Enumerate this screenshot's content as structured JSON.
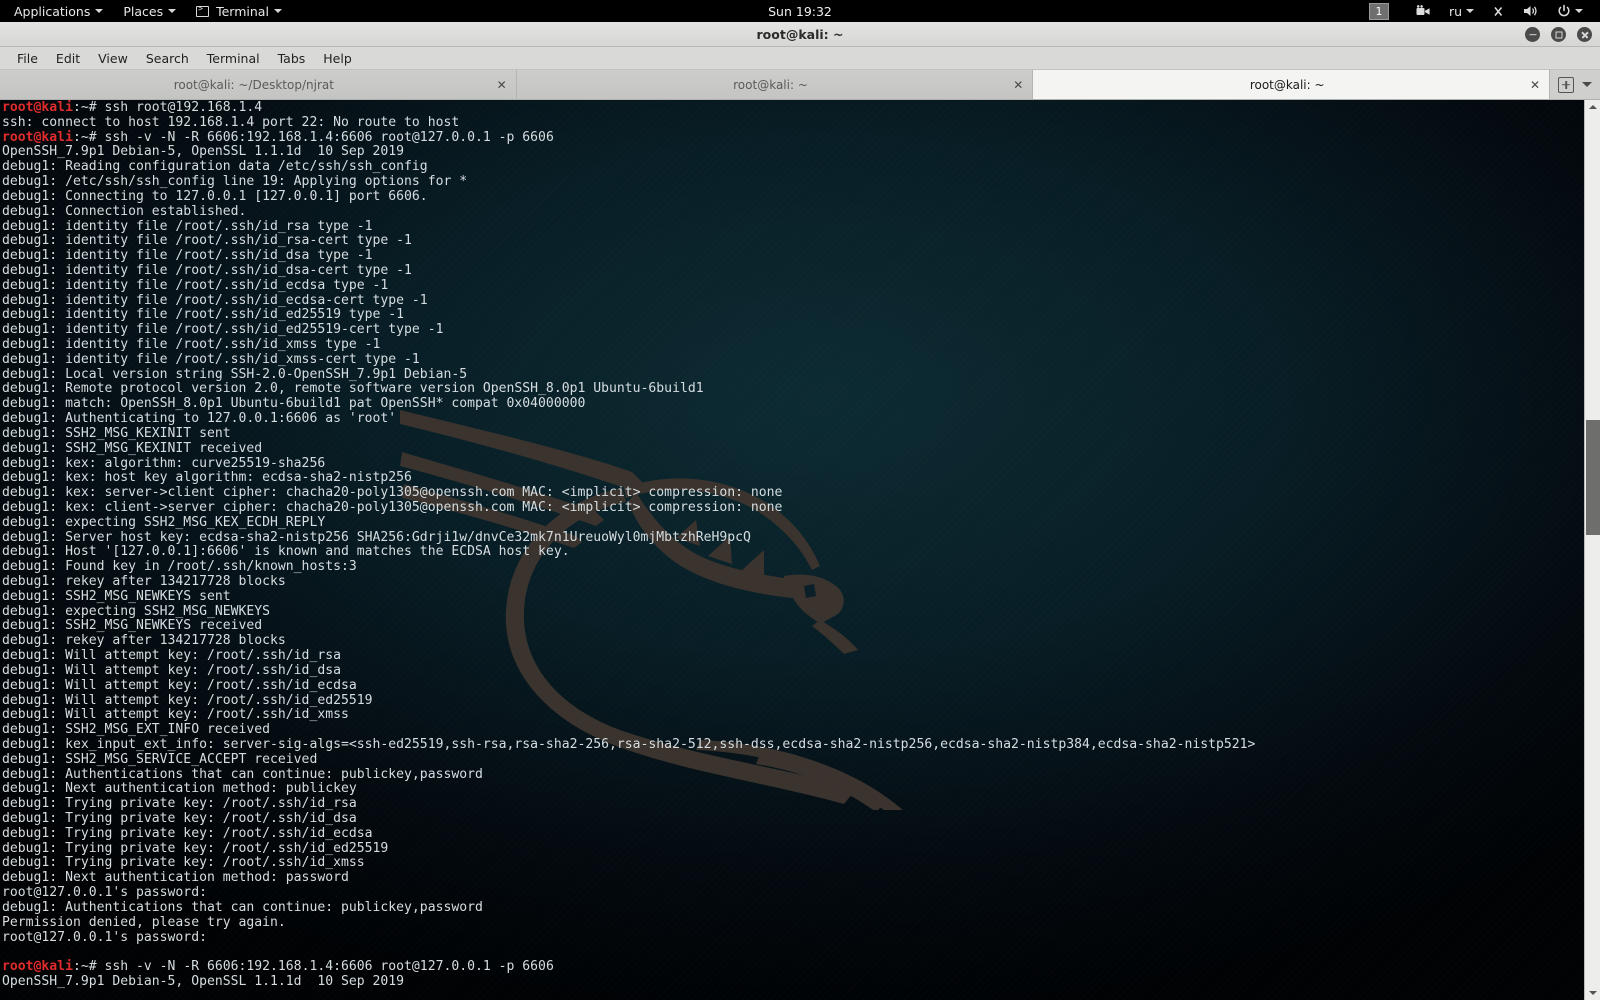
{
  "panel": {
    "applications": "Applications",
    "places": "Places",
    "terminal": "Terminal",
    "clock": "Sun 19:32",
    "workspace": "1",
    "keyboard_layout": "ru"
  },
  "window": {
    "title": "root@kali: ~"
  },
  "menubar": [
    "File",
    "Edit",
    "View",
    "Search",
    "Terminal",
    "Tabs",
    "Help"
  ],
  "tabs": [
    {
      "label": "root@kali: ~/Desktop/njrat",
      "close": "✕",
      "active": false
    },
    {
      "label": "root@kali: ~",
      "close": "✕",
      "active": false
    },
    {
      "label": "root@kali: ~",
      "close": "✕",
      "active": true
    }
  ],
  "colors": {
    "prompt_red": "#e02c2c",
    "terminal_fg": "#d6dde0",
    "terminal_bg": "#04151c",
    "dragon": "#3a332e"
  },
  "terminal": {
    "prompt_user": "root@kali",
    "prompt_tail": ":~# ",
    "lines": [
      {
        "prompt": true,
        "text": "ssh root@192.168.1.4"
      },
      {
        "prompt": false,
        "text": "ssh: connect to host 192.168.1.4 port 22: No route to host"
      },
      {
        "prompt": true,
        "text": "ssh -v -N -R 6606:192.168.1.4:6606 root@127.0.0.1 -p 6606"
      },
      {
        "prompt": false,
        "text": "OpenSSH_7.9p1 Debian-5, OpenSSL 1.1.1d  10 Sep 2019"
      },
      {
        "prompt": false,
        "text": "debug1: Reading configuration data /etc/ssh/ssh_config"
      },
      {
        "prompt": false,
        "text": "debug1: /etc/ssh/ssh_config line 19: Applying options for *"
      },
      {
        "prompt": false,
        "text": "debug1: Connecting to 127.0.0.1 [127.0.0.1] port 6606."
      },
      {
        "prompt": false,
        "text": "debug1: Connection established."
      },
      {
        "prompt": false,
        "text": "debug1: identity file /root/.ssh/id_rsa type -1"
      },
      {
        "prompt": false,
        "text": "debug1: identity file /root/.ssh/id_rsa-cert type -1"
      },
      {
        "prompt": false,
        "text": "debug1: identity file /root/.ssh/id_dsa type -1"
      },
      {
        "prompt": false,
        "text": "debug1: identity file /root/.ssh/id_dsa-cert type -1"
      },
      {
        "prompt": false,
        "text": "debug1: identity file /root/.ssh/id_ecdsa type -1"
      },
      {
        "prompt": false,
        "text": "debug1: identity file /root/.ssh/id_ecdsa-cert type -1"
      },
      {
        "prompt": false,
        "text": "debug1: identity file /root/.ssh/id_ed25519 type -1"
      },
      {
        "prompt": false,
        "text": "debug1: identity file /root/.ssh/id_ed25519-cert type -1"
      },
      {
        "prompt": false,
        "text": "debug1: identity file /root/.ssh/id_xmss type -1"
      },
      {
        "prompt": false,
        "text": "debug1: identity file /root/.ssh/id_xmss-cert type -1"
      },
      {
        "prompt": false,
        "text": "debug1: Local version string SSH-2.0-OpenSSH_7.9p1 Debian-5"
      },
      {
        "prompt": false,
        "text": "debug1: Remote protocol version 2.0, remote software version OpenSSH_8.0p1 Ubuntu-6build1"
      },
      {
        "prompt": false,
        "text": "debug1: match: OpenSSH_8.0p1 Ubuntu-6build1 pat OpenSSH* compat 0x04000000"
      },
      {
        "prompt": false,
        "text": "debug1: Authenticating to 127.0.0.1:6606 as 'root'"
      },
      {
        "prompt": false,
        "text": "debug1: SSH2_MSG_KEXINIT sent"
      },
      {
        "prompt": false,
        "text": "debug1: SSH2_MSG_KEXINIT received"
      },
      {
        "prompt": false,
        "text": "debug1: kex: algorithm: curve25519-sha256"
      },
      {
        "prompt": false,
        "text": "debug1: kex: host key algorithm: ecdsa-sha2-nistp256"
      },
      {
        "prompt": false,
        "text": "debug1: kex: server->client cipher: chacha20-poly1305@openssh.com MAC: <implicit> compression: none"
      },
      {
        "prompt": false,
        "text": "debug1: kex: client->server cipher: chacha20-poly1305@openssh.com MAC: <implicit> compression: none"
      },
      {
        "prompt": false,
        "text": "debug1: expecting SSH2_MSG_KEX_ECDH_REPLY"
      },
      {
        "prompt": false,
        "text": "debug1: Server host key: ecdsa-sha2-nistp256 SHA256:Gdrji1w/dnvCe32mk7n1UreuoWyl0mjMbtzhReH9pcQ"
      },
      {
        "prompt": false,
        "text": "debug1: Host '[127.0.0.1]:6606' is known and matches the ECDSA host key."
      },
      {
        "prompt": false,
        "text": "debug1: Found key in /root/.ssh/known_hosts:3"
      },
      {
        "prompt": false,
        "text": "debug1: rekey after 134217728 blocks"
      },
      {
        "prompt": false,
        "text": "debug1: SSH2_MSG_NEWKEYS sent"
      },
      {
        "prompt": false,
        "text": "debug1: expecting SSH2_MSG_NEWKEYS"
      },
      {
        "prompt": false,
        "text": "debug1: SSH2_MSG_NEWKEYS received"
      },
      {
        "prompt": false,
        "text": "debug1: rekey after 134217728 blocks"
      },
      {
        "prompt": false,
        "text": "debug1: Will attempt key: /root/.ssh/id_rsa"
      },
      {
        "prompt": false,
        "text": "debug1: Will attempt key: /root/.ssh/id_dsa"
      },
      {
        "prompt": false,
        "text": "debug1: Will attempt key: /root/.ssh/id_ecdsa"
      },
      {
        "prompt": false,
        "text": "debug1: Will attempt key: /root/.ssh/id_ed25519"
      },
      {
        "prompt": false,
        "text": "debug1: Will attempt key: /root/.ssh/id_xmss"
      },
      {
        "prompt": false,
        "text": "debug1: SSH2_MSG_EXT_INFO received"
      },
      {
        "prompt": false,
        "text": "debug1: kex_input_ext_info: server-sig-algs=<ssh-ed25519,ssh-rsa,rsa-sha2-256,rsa-sha2-512,ssh-dss,ecdsa-sha2-nistp256,ecdsa-sha2-nistp384,ecdsa-sha2-nistp521>"
      },
      {
        "prompt": false,
        "text": "debug1: SSH2_MSG_SERVICE_ACCEPT received"
      },
      {
        "prompt": false,
        "text": "debug1: Authentications that can continue: publickey,password"
      },
      {
        "prompt": false,
        "text": "debug1: Next authentication method: publickey"
      },
      {
        "prompt": false,
        "text": "debug1: Trying private key: /root/.ssh/id_rsa"
      },
      {
        "prompt": false,
        "text": "debug1: Trying private key: /root/.ssh/id_dsa"
      },
      {
        "prompt": false,
        "text": "debug1: Trying private key: /root/.ssh/id_ecdsa"
      },
      {
        "prompt": false,
        "text": "debug1: Trying private key: /root/.ssh/id_ed25519"
      },
      {
        "prompt": false,
        "text": "debug1: Trying private key: /root/.ssh/id_xmss"
      },
      {
        "prompt": false,
        "text": "debug1: Next authentication method: password"
      },
      {
        "prompt": false,
        "text": "root@127.0.0.1's password:"
      },
      {
        "prompt": false,
        "text": "debug1: Authentications that can continue: publickey,password"
      },
      {
        "prompt": false,
        "text": "Permission denied, please try again."
      },
      {
        "prompt": false,
        "text": "root@127.0.0.1's password:"
      },
      {
        "prompt": false,
        "text": ""
      },
      {
        "prompt": true,
        "text": "ssh -v -N -R 6606:192.168.1.4:6606 root@127.0.0.1 -p 6606"
      },
      {
        "prompt": false,
        "text": "OpenSSH_7.9p1 Debian-5, OpenSSL 1.1.1d  10 Sep 2019"
      }
    ]
  }
}
